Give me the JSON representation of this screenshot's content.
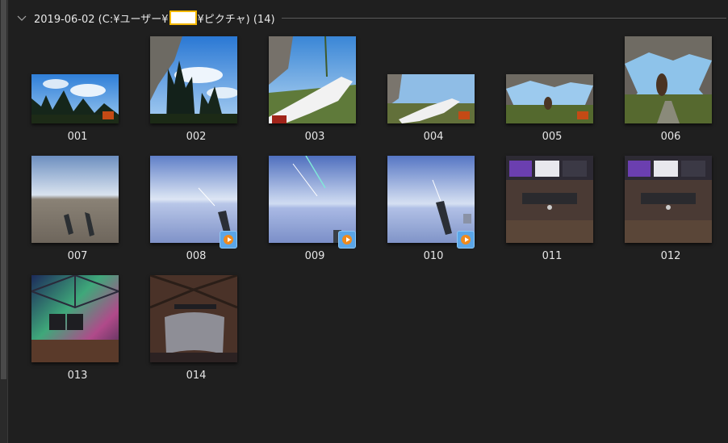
{
  "group": {
    "title_prefix": "2019-06-02 (C:¥ユーザー¥",
    "title_suffix": "¥ピクチャ) (14)",
    "collapse_icon": "chevron-down-icon"
  },
  "colors": {
    "background": "#1f1f1f",
    "redaction_fill": "#ffffff",
    "redaction_border": "#f5b800",
    "play_badge": "#f08a1c"
  },
  "items": [
    {
      "label": "001",
      "scene": "sky-trees-low",
      "video": false
    },
    {
      "label": "002",
      "scene": "sky-trees-tall",
      "video": false
    },
    {
      "label": "003",
      "scene": "hand-rock",
      "video": false
    },
    {
      "label": "004",
      "scene": "hand-field",
      "video": false
    },
    {
      "label": "005",
      "scene": "cave-wide",
      "video": false
    },
    {
      "label": "006",
      "scene": "cave-arch",
      "video": false
    },
    {
      "label": "007",
      "scene": "grey-controllers",
      "video": false
    },
    {
      "label": "008",
      "scene": "blue-controller",
      "video": true
    },
    {
      "label": "009",
      "scene": "blue-beams",
      "video": true
    },
    {
      "label": "010",
      "scene": "blue-controller2",
      "video": true
    },
    {
      "label": "011",
      "scene": "vr-menu",
      "video": false
    },
    {
      "label": "012",
      "scene": "vr-menu",
      "video": false
    },
    {
      "label": "013",
      "scene": "aurora-room",
      "video": false
    },
    {
      "label": "014",
      "scene": "dome-panel",
      "video": false
    }
  ]
}
